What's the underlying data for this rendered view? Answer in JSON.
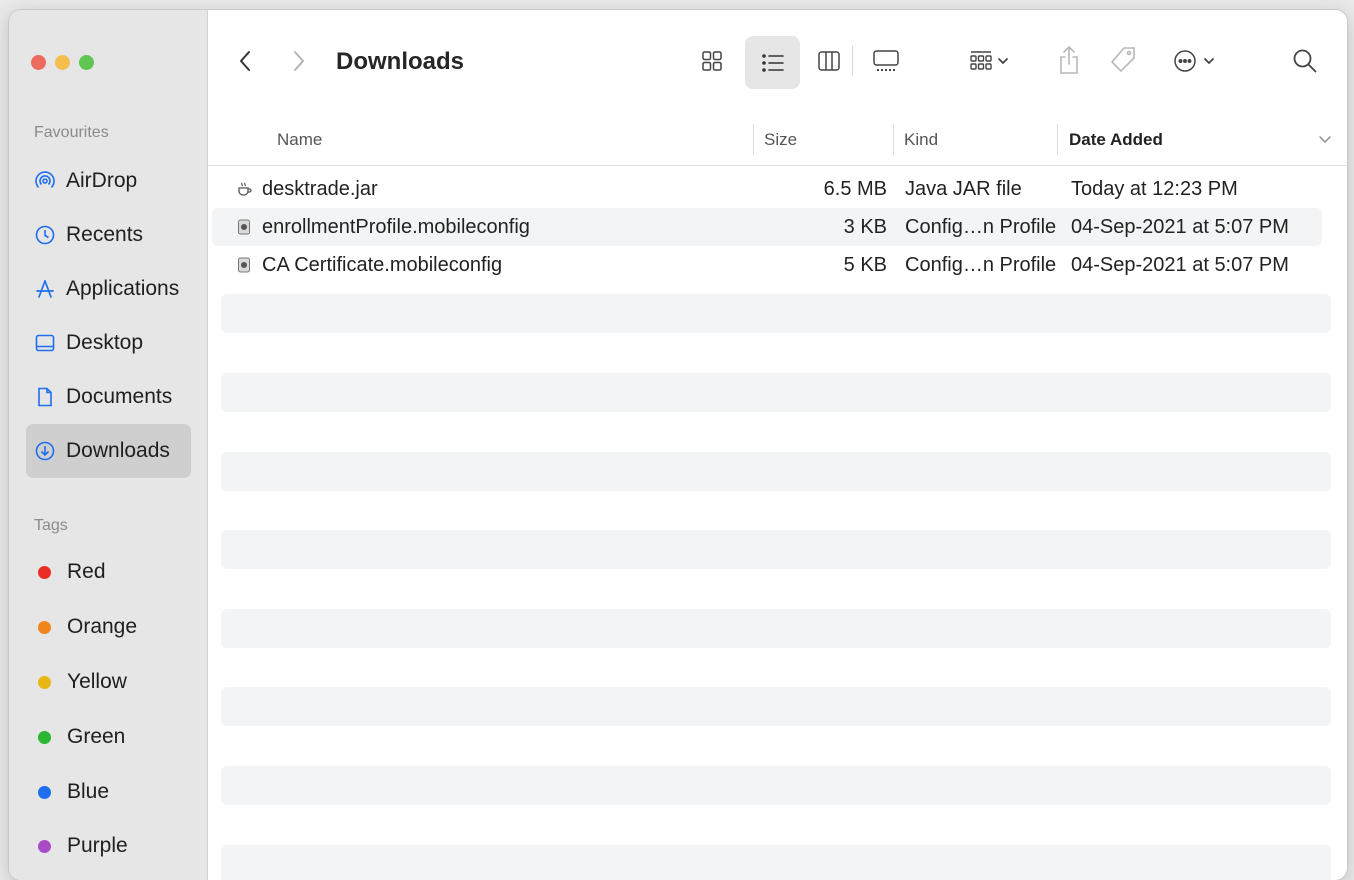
{
  "window": {
    "title": "Downloads"
  },
  "sidebar": {
    "favourites_label": "Favourites",
    "items": [
      {
        "label": "AirDrop",
        "icon": "airdrop-icon"
      },
      {
        "label": "Recents",
        "icon": "clock-icon"
      },
      {
        "label": "Applications",
        "icon": "applications-icon"
      },
      {
        "label": "Desktop",
        "icon": "desktop-icon"
      },
      {
        "label": "Documents",
        "icon": "document-icon"
      },
      {
        "label": "Downloads",
        "icon": "download-icon",
        "selected": true
      }
    ],
    "tags_label": "Tags",
    "tags": [
      {
        "label": "Red",
        "color": "#ec2d26"
      },
      {
        "label": "Orange",
        "color": "#f0851c"
      },
      {
        "label": "Yellow",
        "color": "#e8b714"
      },
      {
        "label": "Green",
        "color": "#2bb634"
      },
      {
        "label": "Blue",
        "color": "#1e6ff0"
      },
      {
        "label": "Purple",
        "color": "#a94ac7"
      }
    ]
  },
  "toolbar": {
    "back_icon": "chevron-left-icon",
    "forward_icon": "chevron-right-icon",
    "view_modes": [
      "icon-view",
      "list-view",
      "column-view",
      "gallery-view"
    ],
    "active_view": "list-view"
  },
  "table": {
    "columns": {
      "name": "Name",
      "size": "Size",
      "kind": "Kind",
      "date": "Date Added"
    },
    "sort_column": "date",
    "rows": [
      {
        "name": "desktrade.jar",
        "size": "6.5 MB",
        "kind": "Java JAR file",
        "date": "Today at 12:23 PM",
        "icon": "jar-icon"
      },
      {
        "name": "enrollmentProfile.mobileconfig",
        "size": "3 KB",
        "kind": "Config…n Profile",
        "date": "04-Sep-2021 at 5:07 PM",
        "icon": "profile-icon"
      },
      {
        "name": "CA Certificate.mobileconfig",
        "size": "5 KB",
        "kind": "Config…n Profile",
        "date": "04-Sep-2021 at 5:07 PM",
        "icon": "profile-icon"
      }
    ]
  },
  "colors": {
    "close": "#ed6a5e",
    "minimize": "#f5bf4f",
    "zoom": "#61c554",
    "accent": "#1e6ff0",
    "stripe": "#f2f4f5"
  }
}
